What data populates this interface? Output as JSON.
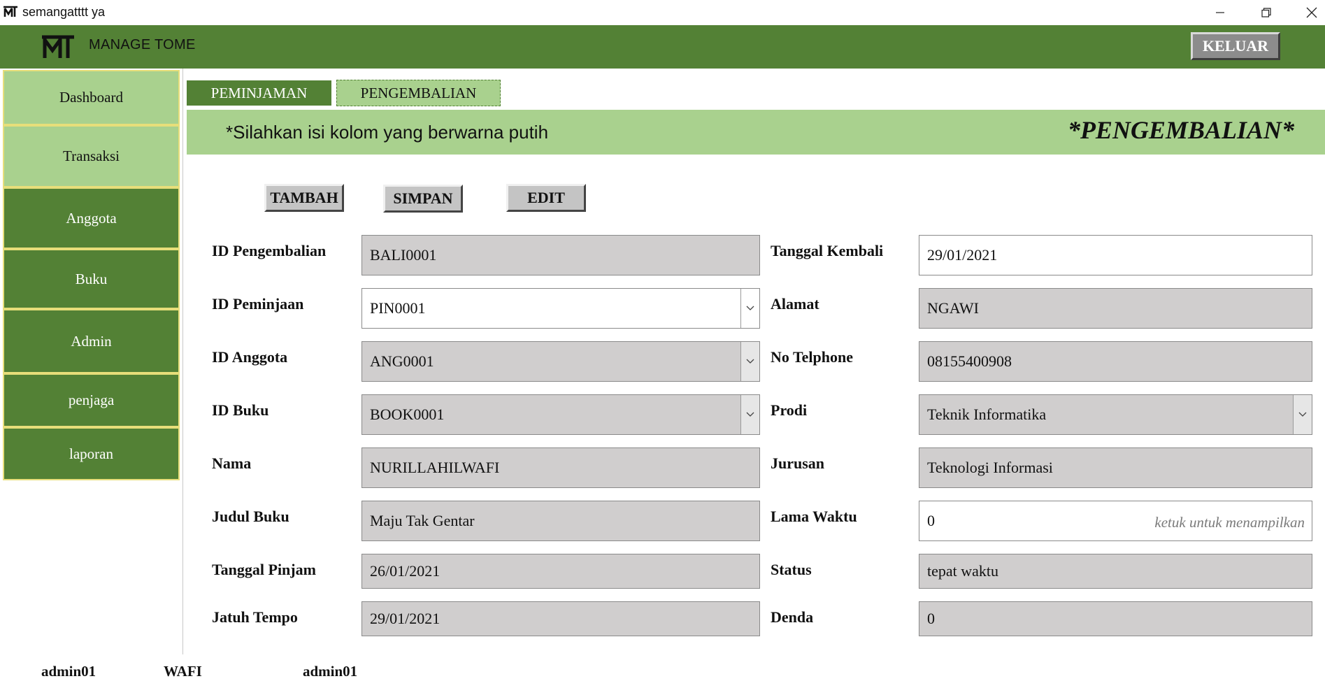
{
  "window": {
    "title": "semangatttt ya"
  },
  "header": {
    "app_title": "MANAGE TOME",
    "logout_label": "KELUAR"
  },
  "sidebar": {
    "items": [
      {
        "label": "Dashboard"
      },
      {
        "label": "Transaksi"
      },
      {
        "label": "Anggota"
      },
      {
        "label": "Buku"
      },
      {
        "label": "Admin"
      },
      {
        "label": "penjaga"
      },
      {
        "label": "laporan"
      }
    ]
  },
  "tabs": [
    {
      "label": "PEMINJAMAN"
    },
    {
      "label": "PENGEMBALIAN",
      "active": true
    }
  ],
  "banner": {
    "hint": "*Silahkan isi kolom yang berwarna putih",
    "heading": "*PENGEMBALIAN*"
  },
  "actions": {
    "add_label": "TAMBAH",
    "save_label": "SIMPAN",
    "edit_label": "EDIT"
  },
  "form": {
    "id_pengembalian": {
      "label": "ID Pengembalian",
      "value": "BALI0001"
    },
    "id_peminjaan": {
      "label": "ID Peminjaan",
      "value": "PIN0001"
    },
    "id_anggota": {
      "label": "ID Anggota",
      "value": "ANG0001"
    },
    "id_buku": {
      "label": "ID Buku",
      "value": "BOOK0001"
    },
    "nama": {
      "label": "Nama",
      "value": "NURILLAHILWAFI"
    },
    "judul_buku": {
      "label": "Judul Buku",
      "value": "Maju Tak Gentar"
    },
    "tanggal_pinjam": {
      "label": "Tanggal Pinjam",
      "value": "26/01/2021"
    },
    "jatuh_tempo": {
      "label": "Jatuh Tempo",
      "value": "29/01/2021"
    },
    "tanggal_kembali": {
      "label": "Tanggal Kembali",
      "value": "29/01/2021"
    },
    "alamat": {
      "label": "Alamat",
      "value": "NGAWI"
    },
    "no_telphone": {
      "label": "No Telphone",
      "value": "08155400908"
    },
    "prodi": {
      "label": "Prodi",
      "value": "Teknik Informatika"
    },
    "jurusan": {
      "label": "Jurusan",
      "value": "Teknologi Informasi"
    },
    "lama_waktu": {
      "label": "Lama Waktu",
      "value": "0",
      "hint": "ketuk untuk menampilkan"
    },
    "status": {
      "label": "Status",
      "value": "tepat waktu"
    },
    "denda": {
      "label": "Denda",
      "value": "0"
    }
  },
  "footer": {
    "user_id": "admin01",
    "user_name": "WAFI",
    "user_role": "admin01"
  },
  "colors": {
    "dark_green": "#538135",
    "light_green": "#a9d18e",
    "readonly_field": "#d0cece"
  }
}
